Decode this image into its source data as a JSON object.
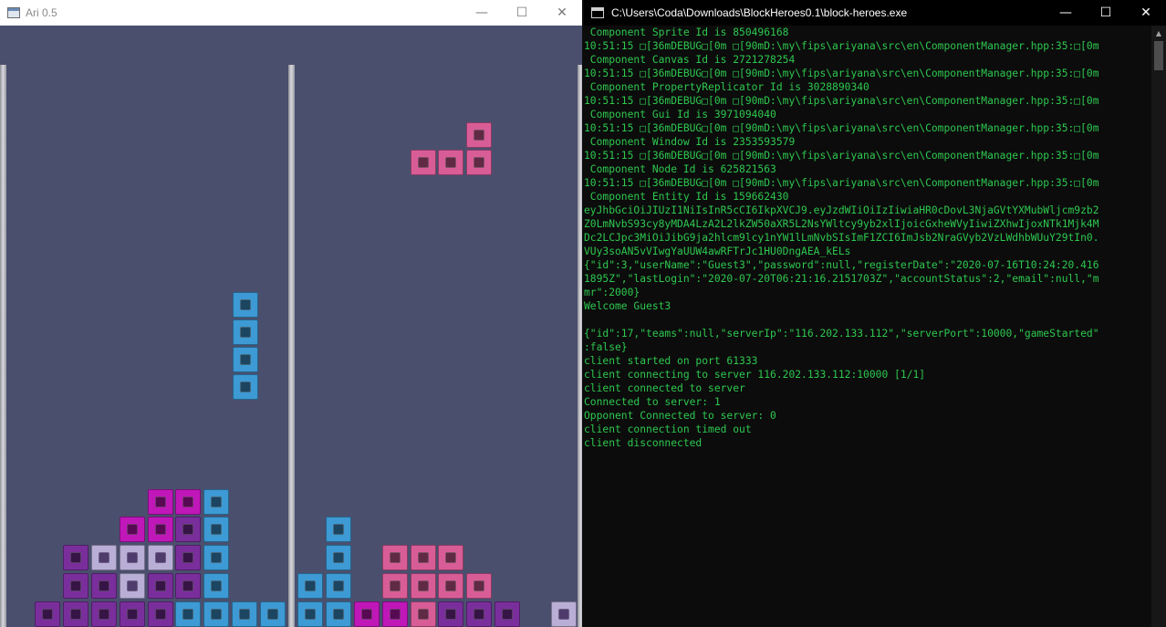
{
  "game_window": {
    "title": "Ari 0.5",
    "controls": {
      "minimize": "—",
      "maximize": "☐",
      "close": "✕"
    }
  },
  "console_window": {
    "title": "C:\\Users\\Coda\\Downloads\\BlockHeroes0.1\\block-heroes.exe",
    "controls": {
      "minimize": "—",
      "maximize": "☐",
      "close": "✕"
    },
    "lines": [
      " Component Sprite Id is 850496168",
      "10:51:15 □[36mDEBUG□[0m □[90mD:\\my\\fips\\ariyana\\src\\en\\ComponentManager.hpp:35:□[0m",
      " Component Canvas Id is 2721278254",
      "10:51:15 □[36mDEBUG□[0m □[90mD:\\my\\fips\\ariyana\\src\\en\\ComponentManager.hpp:35:□[0m",
      " Component PropertyReplicator Id is 3028890340",
      "10:51:15 □[36mDEBUG□[0m □[90mD:\\my\\fips\\ariyana\\src\\en\\ComponentManager.hpp:35:□[0m",
      " Component Gui Id is 3971094040",
      "10:51:15 □[36mDEBUG□[0m □[90mD:\\my\\fips\\ariyana\\src\\en\\ComponentManager.hpp:35:□[0m",
      " Component Window Id is 2353593579",
      "10:51:15 □[36mDEBUG□[0m □[90mD:\\my\\fips\\ariyana\\src\\en\\ComponentManager.hpp:35:□[0m",
      " Component Node Id is 625821563",
      "10:51:15 □[36mDEBUG□[0m □[90mD:\\my\\fips\\ariyana\\src\\en\\ComponentManager.hpp:35:□[0m",
      " Component Entity Id is 159662430",
      "eyJhbGciOiJIUzI1NiIsInR5cCI6IkpXVCJ9.eyJzdWIiOiIzIiwiaHR0cDovL3NjaGVtYXMubWljcm9zb2",
      "Z0LmNvbS93cy8yMDA4LzA2L2lkZW50aXR5L2NsYWltcy9yb2xlIjoicGxheWVyIiwiZXhwIjoxNTk1Mjk4M",
      "Dc2LCJpc3MiOiJibG9ja2hlcm9lcy1nYW1lLmNvbSIsImF1ZCI6ImJsb2NraGVyb2VzLWdhbWUuY29tIn0.",
      "VUy3soAN5vVIwgYaUUW4awRFTrJc1HU0DngAEA_kELs",
      "{\"id\":3,\"userName\":\"Guest3\",\"password\":null,\"registerDate\":\"2020-07-16T10:24:20.416",
      "1895Z\",\"lastLogin\":\"2020-07-20T06:21:16.2151703Z\",\"accountStatus\":2,\"email\":null,\"m",
      "mr\":2000}",
      "Welcome Guest3",
      "",
      "{\"id\":17,\"teams\":null,\"serverIp\":\"116.202.133.112\",\"serverPort\":10000,\"gameStarted\"",
      ":false}",
      "client started on port 61333",
      "client connecting to server 116.202.133.112:10000 [1/1]",
      "client connected to server",
      "Connected to server: 1",
      "Opponent Connected to server: 0",
      "client connection timed out",
      "client disconnected"
    ]
  },
  "colors": {
    "game_background": "#4a4f6e",
    "console_background": "#0c0c0c",
    "console_text": "#2ec84f",
    "block_blue": "#3d9ad4",
    "block_pink": "#d85d97",
    "block_magenta": "#c017b9",
    "block_purple": "#7a2e9c",
    "block_lavender": "#b9aed6"
  },
  "game_board": {
    "cell_colors": [
      "blue",
      "pink",
      "magenta",
      "purple",
      "lavender"
    ],
    "left_board": {
      "falling_piece": {
        "shape": "I",
        "color": "blue"
      },
      "stack_rows_from_bottom": [
        [
          "purple",
          "purple",
          "purple",
          "purple",
          "purple",
          "blue",
          "blue",
          "blue",
          "blue"
        ],
        [
          "empty",
          "purple",
          "purple",
          "lavender",
          "purple",
          "purple",
          "blue",
          "empty",
          "empty"
        ],
        [
          "empty",
          "purple",
          "lavender",
          "lavender",
          "lavender",
          "purple",
          "blue",
          "empty",
          "empty"
        ],
        [
          "empty",
          "empty",
          "empty",
          "magenta",
          "magenta",
          "purple",
          "blue",
          "empty",
          "empty"
        ],
        [
          "empty",
          "empty",
          "empty",
          "empty",
          "magenta",
          "magenta",
          "blue",
          "empty",
          "empty"
        ]
      ]
    },
    "right_board": {
      "falling_piece": {
        "shape": "L",
        "color": "pink"
      },
      "stack_rows_from_bottom": [
        [
          "blue",
          "blue",
          "magenta",
          "magenta",
          "pink",
          "purple",
          "purple",
          "purple",
          "empty",
          "lavender"
        ],
        [
          "blue",
          "blue",
          "empty",
          "pink",
          "pink",
          "pink",
          "pink",
          "empty",
          "empty",
          "empty"
        ],
        [
          "empty",
          "blue",
          "empty",
          "pink",
          "pink",
          "pink",
          "empty",
          "empty",
          "empty",
          "empty"
        ],
        [
          "empty",
          "blue",
          "empty",
          "empty",
          "empty",
          "empty",
          "empty",
          "empty",
          "empty",
          "empty"
        ]
      ]
    }
  }
}
